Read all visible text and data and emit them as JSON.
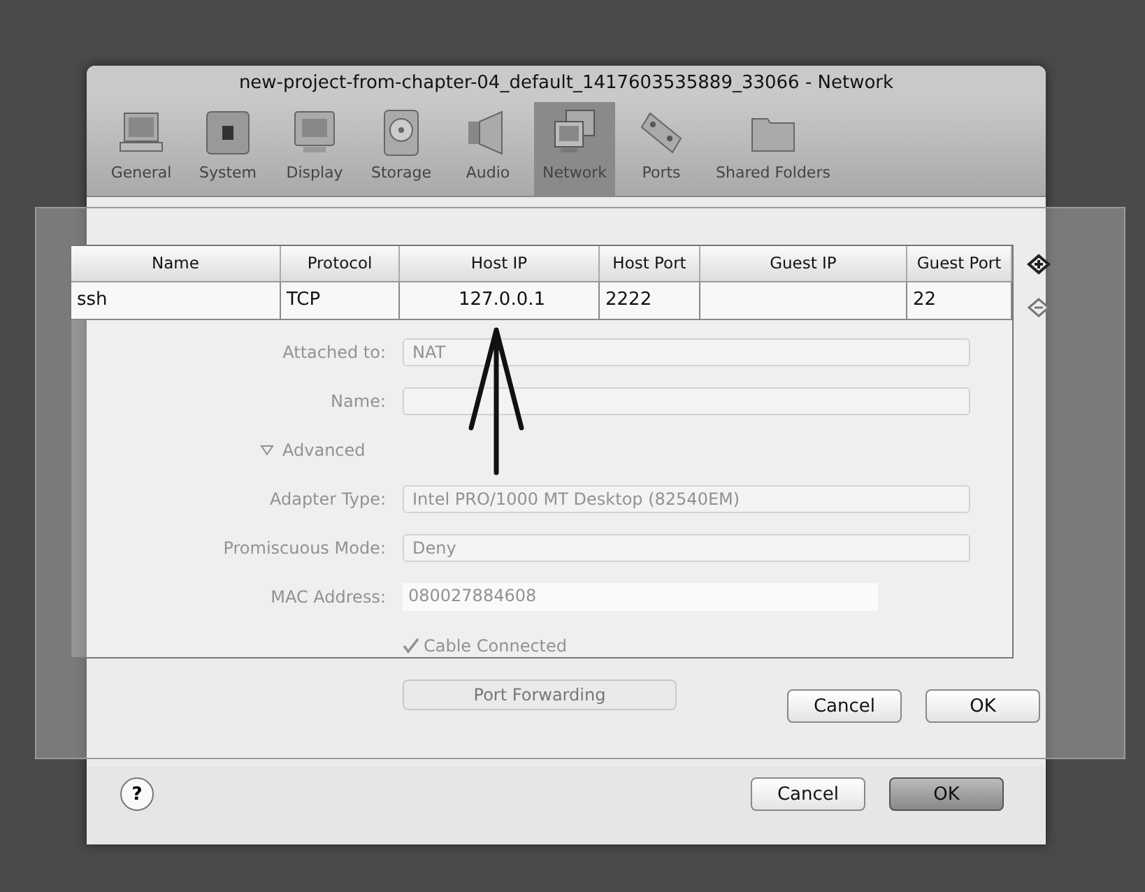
{
  "window": {
    "title": "new-project-from-chapter-04_default_1417603535889_33066 - Network"
  },
  "toolbar": [
    {
      "kind": "general",
      "label": "General",
      "selected": false
    },
    {
      "kind": "system",
      "label": "System",
      "selected": false
    },
    {
      "kind": "display",
      "label": "Display",
      "selected": false
    },
    {
      "kind": "storage",
      "label": "Storage",
      "selected": false
    },
    {
      "kind": "audio",
      "label": "Audio",
      "selected": false
    },
    {
      "kind": "network",
      "label": "Network",
      "selected": true
    },
    {
      "kind": "ports",
      "label": "Ports",
      "selected": false
    },
    {
      "kind": "folders",
      "label": "Shared Folders",
      "selected": false
    }
  ],
  "adapter_settings": [
    {
      "kind": "select",
      "label": "Attached to:",
      "value": "NAT"
    },
    {
      "kind": "select",
      "label": "Name:"
    },
    {
      "kind": "disclosure",
      "label": "Advanced",
      "expanded": true
    },
    {
      "kind": "select",
      "label": "Adapter Type:",
      "value": "Intel PRO/1000 MT Desktop (82540EM)"
    },
    {
      "kind": "select",
      "label": "Promiscuous Mode:",
      "value": "Deny"
    },
    {
      "kind": "text",
      "label": "MAC Address:",
      "value": "080027884608"
    },
    {
      "kind": "checkbox",
      "label": "Cable Connected",
      "checked": true
    },
    {
      "kind": "button",
      "label": "Port Forwarding"
    }
  ],
  "port_forwarding_sheet": {
    "columns": [
      "Name",
      "Protocol",
      "Host IP",
      "Host Port",
      "Guest IP",
      "Guest Port"
    ],
    "rows": [
      {
        "name": "ssh",
        "protocol": "TCP",
        "host_ip": "127.0.0.1",
        "host_port": "2222",
        "guest_port": "22"
      }
    ],
    "buttons": [
      {
        "label": "Cancel",
        "default": false
      },
      {
        "label": "OK",
        "default": false
      }
    ]
  },
  "footer": {
    "help": "?",
    "buttons": [
      {
        "label": "Cancel",
        "default": false
      },
      {
        "label": "OK",
        "default": true
      }
    ]
  }
}
